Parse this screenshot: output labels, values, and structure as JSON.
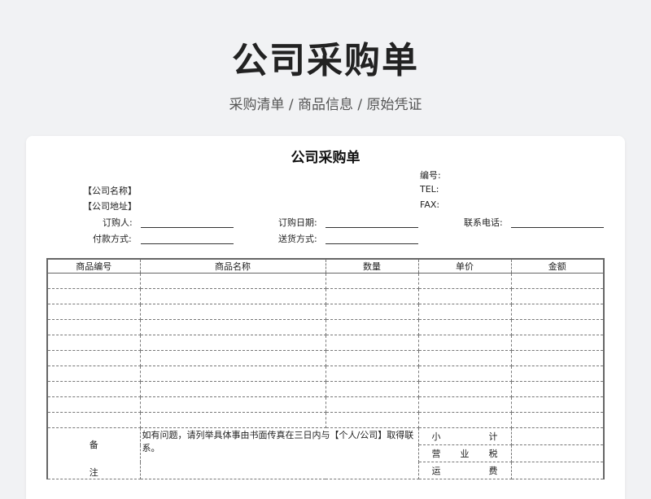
{
  "header": {
    "title": "公司采购单",
    "subtitle": "采购清单 / 商品信息 / 原始凭证"
  },
  "document": {
    "title": "公司采购单",
    "number_label": "编号:",
    "company_name_label": "【公司名称】",
    "company_address_label": "【公司地址】",
    "tel_label": "TEL:",
    "fax_label": "FAX:",
    "orderer_label": "订购人:",
    "order_date_label": "订购日期:",
    "contact_phone_label": "联系电话:",
    "payment_label": "付款方式:",
    "delivery_label": "送货方式:",
    "table": {
      "headers": [
        "商品编号",
        "商品名称",
        "数量",
        "单价",
        "金额"
      ],
      "empty_rows": 10
    },
    "remarks": {
      "label_top": "备",
      "label_bottom": "注",
      "text": "如有问题，请列举具体事由书面传真在三日内与【个人/公司】取得联系。"
    },
    "summary": [
      {
        "left": "小",
        "right": "计"
      },
      {
        "left": "营",
        "mid": "业",
        "right": "税"
      },
      {
        "left": "运",
        "right": "费"
      }
    ]
  }
}
